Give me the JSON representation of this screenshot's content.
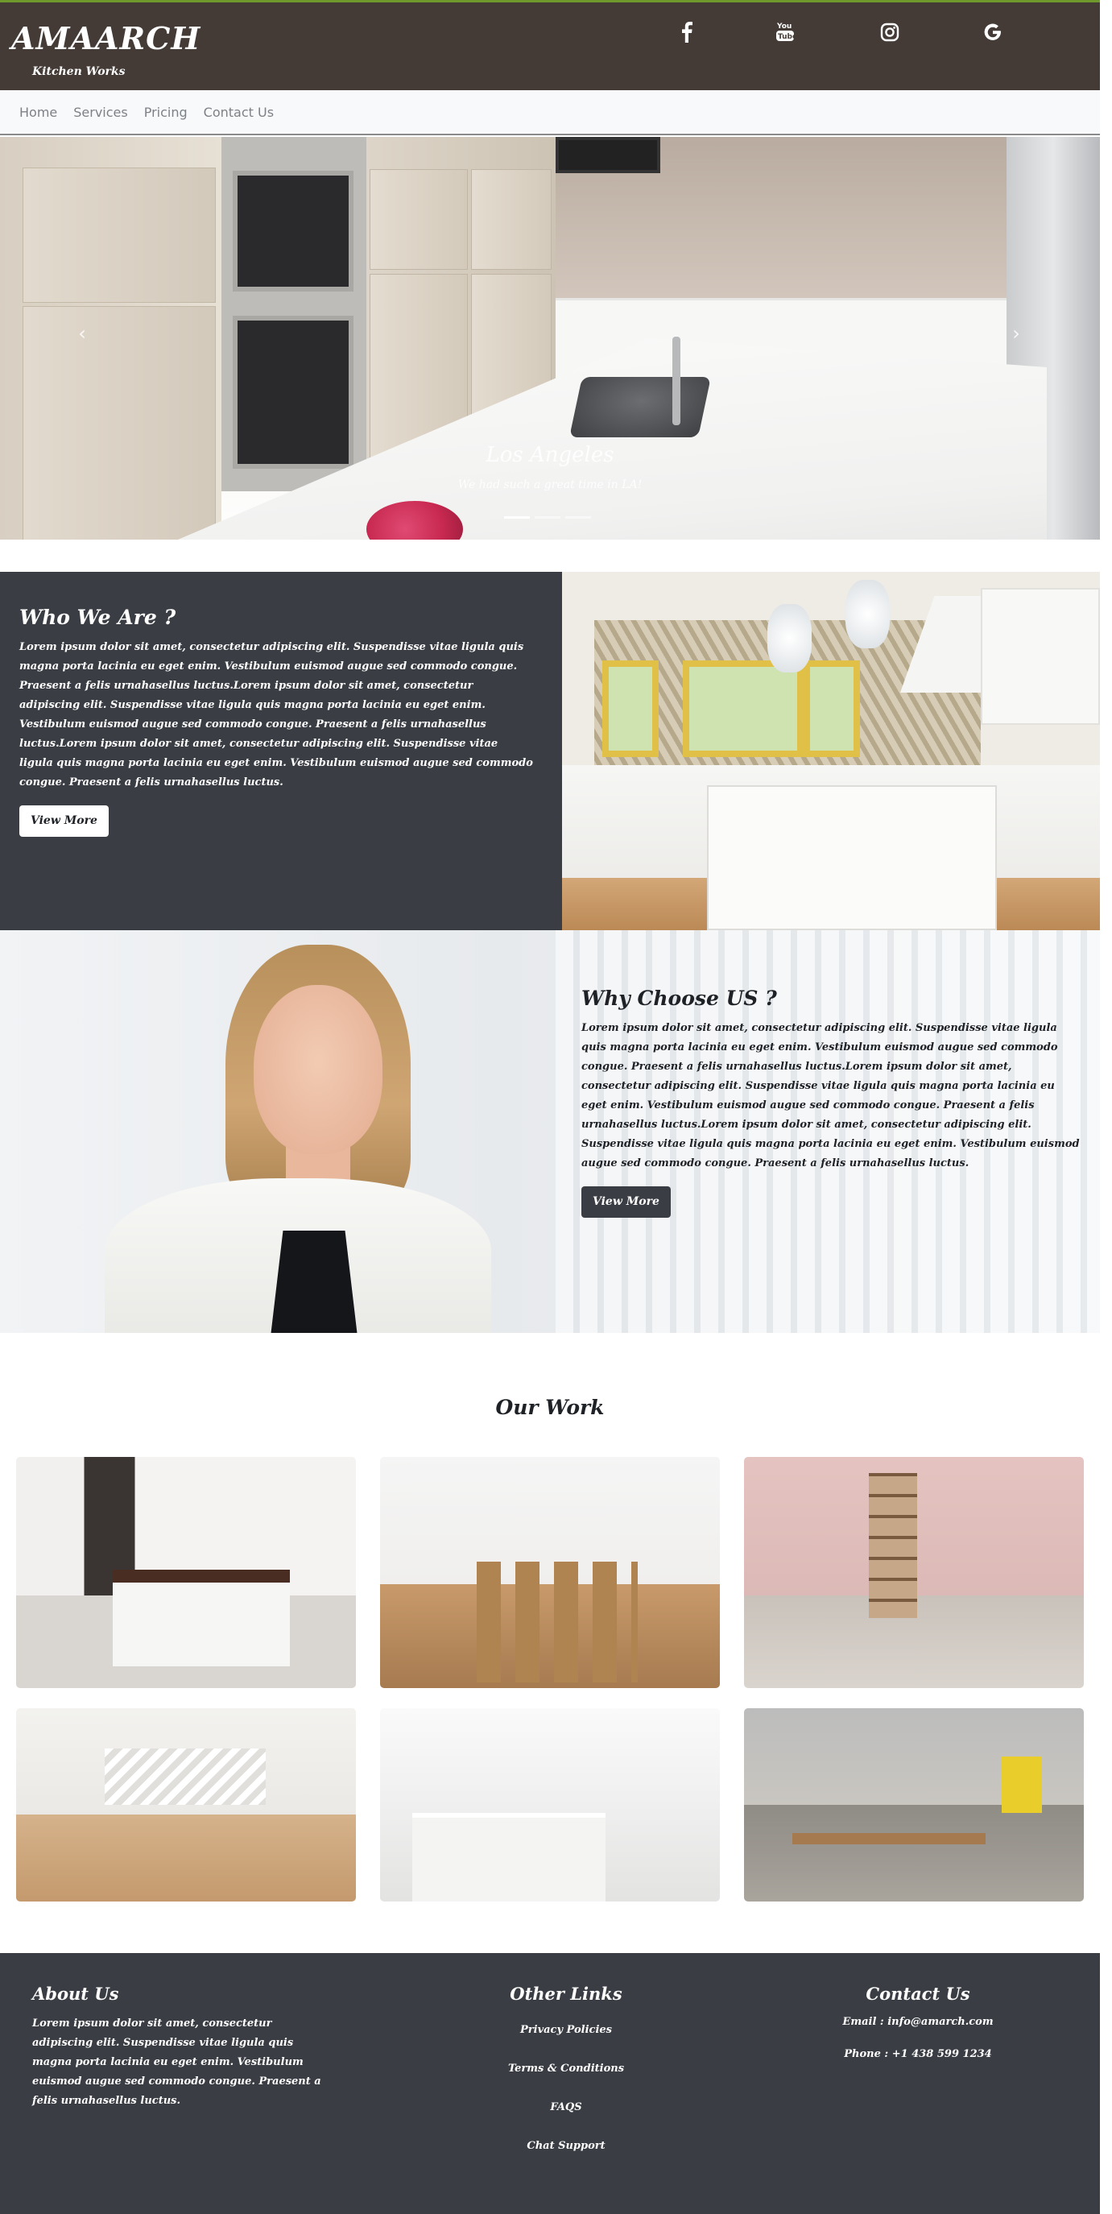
{
  "header": {
    "logo": "AMAARCH",
    "tagline": "Kitchen Works",
    "social": [
      "facebook-icon",
      "youtube-icon",
      "instagram-icon",
      "google-icon"
    ],
    "colors": {
      "header_bg": "#443b37",
      "accent_line": "#6f9a2b"
    }
  },
  "nav": {
    "items": [
      {
        "label": "Home"
      },
      {
        "label": "Services"
      },
      {
        "label": "Pricing"
      },
      {
        "label": "Contact Us"
      }
    ]
  },
  "hero": {
    "caption_title": "Los Angeles",
    "caption_text": "We had such a great time in LA!",
    "prev_icon": "chevron-left-icon",
    "next_icon": "chevron-right-icon",
    "slides": 3,
    "active_slide": 1
  },
  "who": {
    "title": "Who We Are ?",
    "text": "Lorem ipsum dolor sit amet, consectetur adipiscing elit. Suspendisse vitae ligula quis magna porta lacinia eu eget enim. Vestibulum euismod augue sed commodo congue. Praesent a felis urnahasellus luctus.Lorem ipsum dolor sit amet, consectetur adipiscing elit. Suspendisse vitae ligula quis magna porta lacinia eu eget enim. Vestibulum euismod augue sed commodo congue. Praesent a felis urnahasellus luctus.Lorem ipsum dolor sit amet, consectetur adipiscing elit. Suspendisse vitae ligula quis magna porta lacinia eu eget enim. Vestibulum euismod augue sed commodo congue. Praesent a felis urnahasellus luctus.",
    "button": "View More",
    "colors": {
      "panel_bg": "#3a3e44"
    }
  },
  "why": {
    "title": "Why Choose US ?",
    "text": "Lorem ipsum dolor sit amet, consectetur adipiscing elit. Suspendisse vitae ligula quis magna porta lacinia eu eget enim. Vestibulum euismod augue sed commodo congue. Praesent a felis urnahasellus luctus.Lorem ipsum dolor sit amet, consectetur adipiscing elit. Suspendisse vitae ligula quis magna porta lacinia eu eget enim. Vestibulum euismod augue sed commodo congue. Praesent a felis urnahasellus luctus.Lorem ipsum dolor sit amet, consectetur adipiscing elit. Suspendisse vitae ligula quis magna porta lacinia eu eget enim. Vestibulum euismod augue sed commodo congue. Praesent a felis urnahasellus luctus.",
    "button": "View More"
  },
  "work": {
    "title": "Our Work"
  },
  "footer": {
    "about_title": "About Us",
    "about_text": "Lorem ipsum dolor sit amet, consectetur adipiscing elit. Suspendisse vitae ligula quis magna porta lacinia eu eget enim. Vestibulum euismod augue sed commodo congue. Praesent a felis urnahasellus luctus.",
    "links_title": "Other Links",
    "links": [
      {
        "label": "Privacy Policies"
      },
      {
        "label": "Terms & Conditions"
      },
      {
        "label": "FAQS"
      },
      {
        "label": "Chat Support"
      }
    ],
    "contact_title": "Contact Us",
    "email_label": "Email : info@amarch.com",
    "phone_label": "Phone : +1 438 599 1234",
    "colors": {
      "footer_bg": "#3a3e44"
    }
  }
}
